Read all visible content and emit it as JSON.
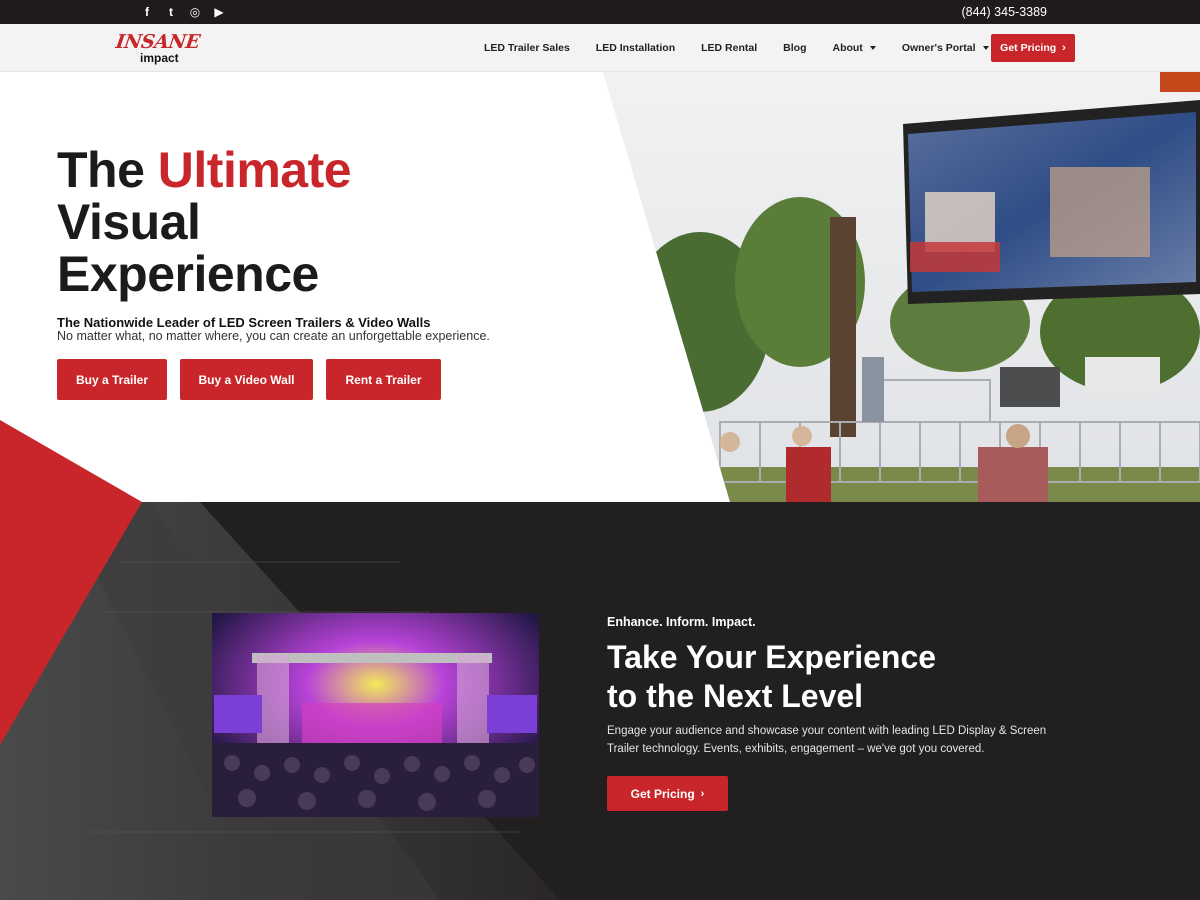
{
  "topbar": {
    "social": [
      {
        "icon": "facebook-icon",
        "glyph": "f"
      },
      {
        "icon": "twitter-icon",
        "glyph": "t"
      },
      {
        "icon": "instagram-icon",
        "glyph": "◎"
      },
      {
        "icon": "youtube-icon",
        "glyph": "▶"
      }
    ],
    "phone": "(844) 345-3389"
  },
  "header": {
    "logo_top": "INSANE",
    "logo_bottom": "impact",
    "nav": [
      {
        "label": "LED Trailer Sales"
      },
      {
        "label": "LED Installation"
      },
      {
        "label": "LED Rental"
      },
      {
        "label": "Blog"
      },
      {
        "label": "About",
        "dropdown": true
      },
      {
        "label": "Owner's Portal",
        "dropdown": true
      }
    ],
    "cta": "Get Pricing"
  },
  "hero": {
    "title_part1": "The ",
    "title_highlight": "Ultimate",
    "title_line2": "Visual",
    "title_line3": "Experience",
    "subtitle": "The Nationwide Leader of LED Screen Trailers & Video Walls",
    "description": "No matter what, no matter where, you can create an unforgettable experience.",
    "buttons": [
      "Buy a Trailer",
      "Buy a Video Wall",
      "Rent a Trailer"
    ]
  },
  "section2": {
    "eyebrow": "Enhance. Inform. Impact.",
    "title_line1": "Take Your Experience",
    "title_line2": "to the Next Level",
    "description": "Engage your audience and showcase your content with leading LED Display & Screen Trailer technology. Events, exhibits, engagement – we've got you covered.",
    "button": "Get Pricing"
  },
  "colors": {
    "accent": "#c8262a",
    "dark": "#221f20",
    "topbar": "#1f1b1c"
  }
}
